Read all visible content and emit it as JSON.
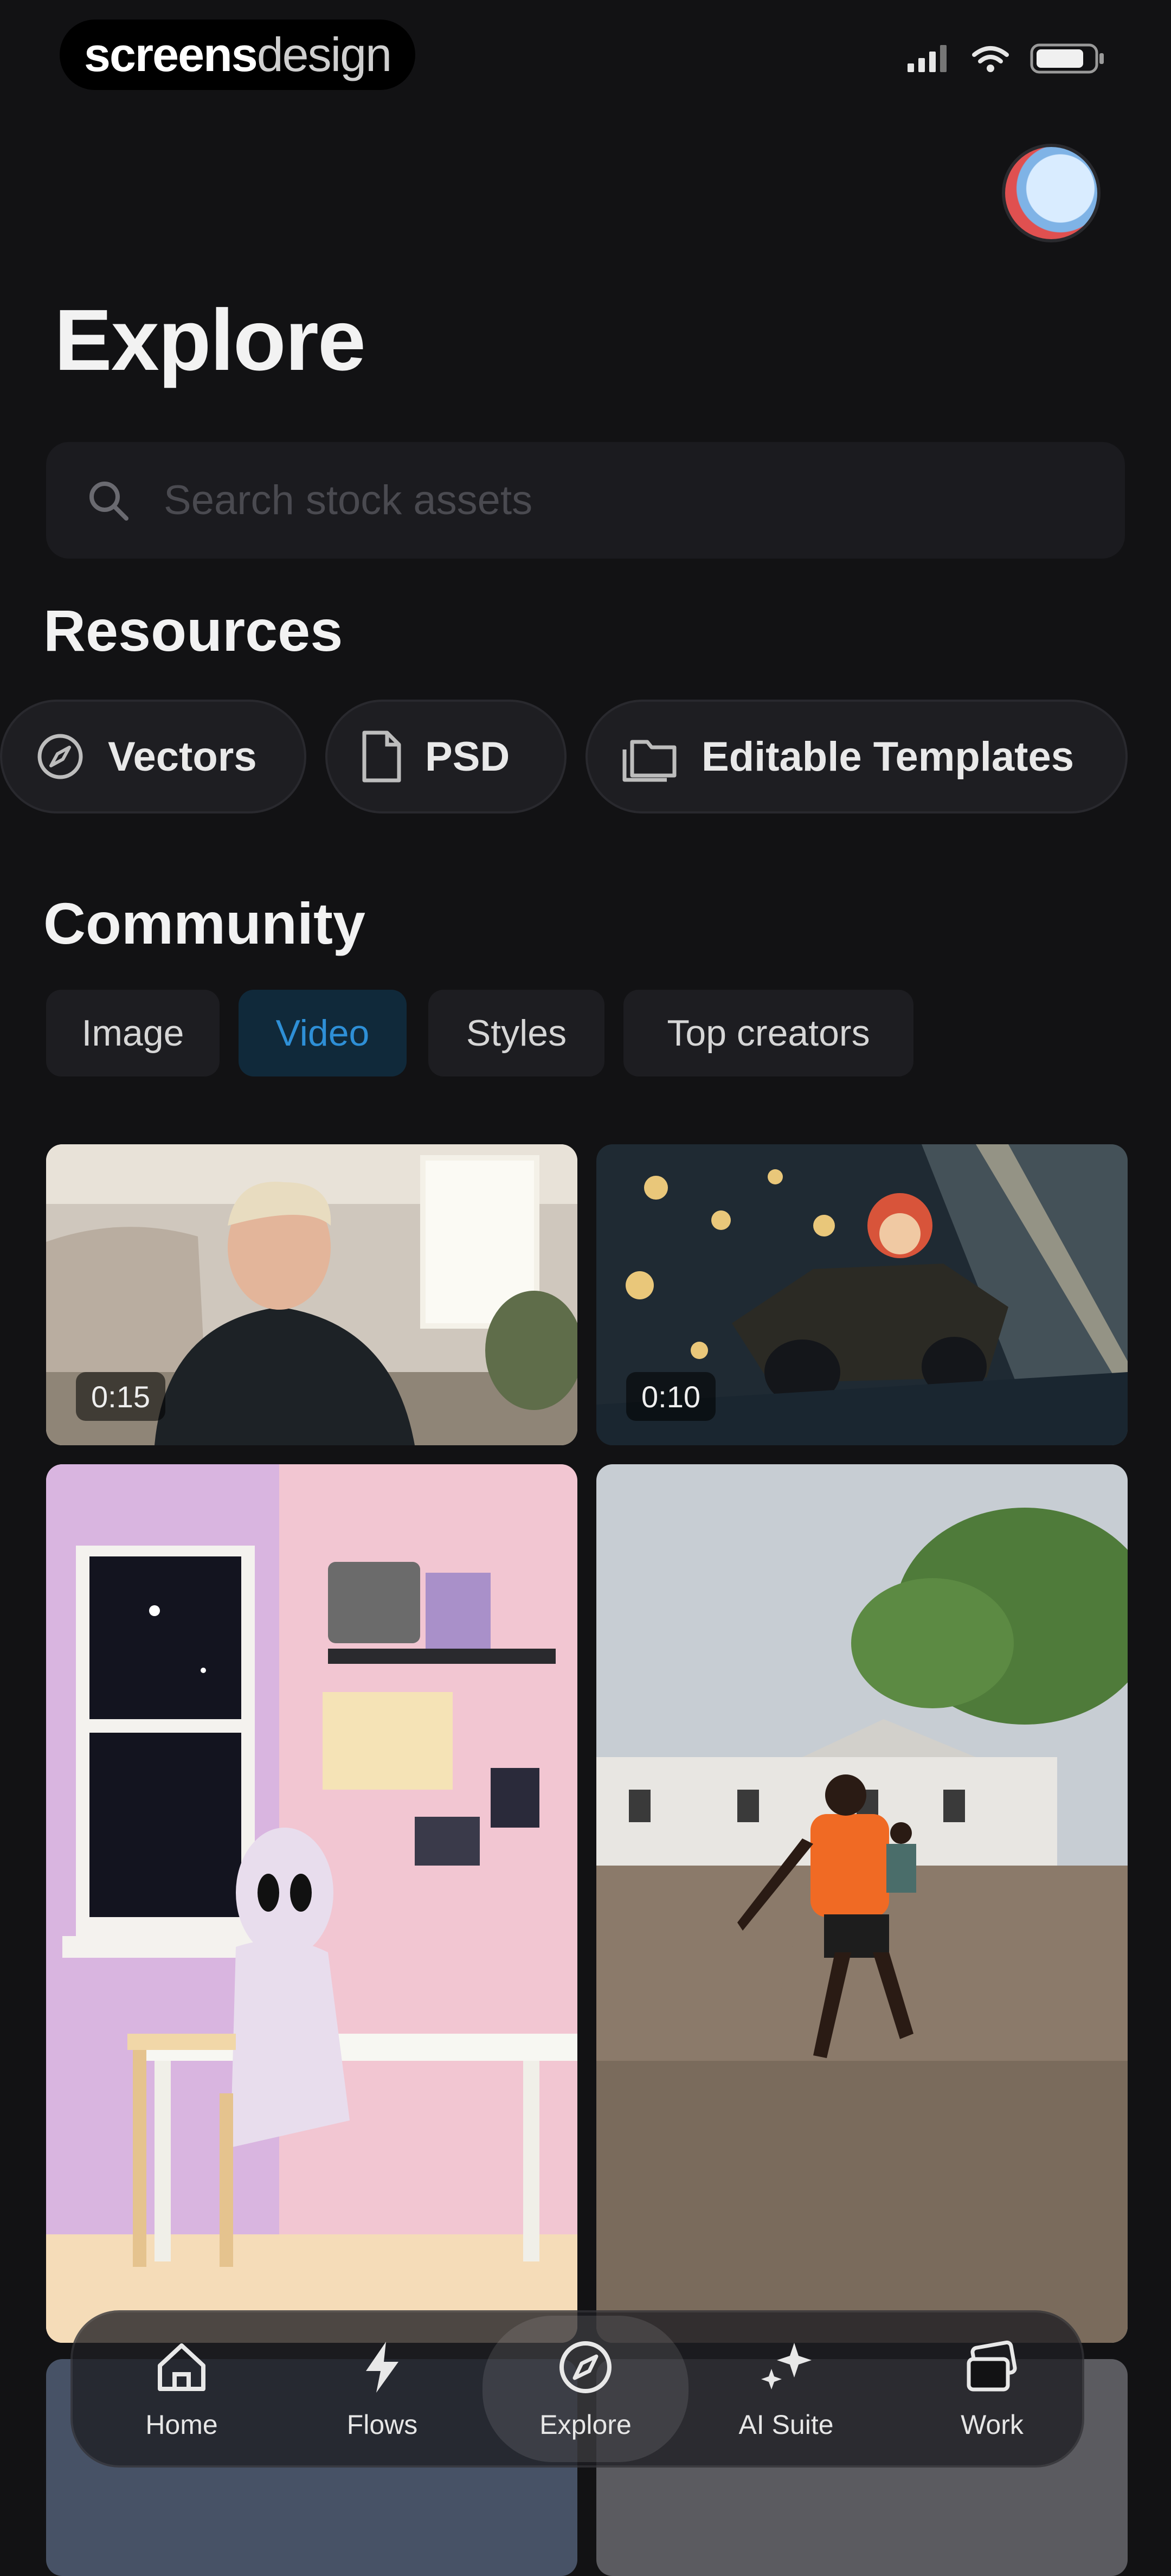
{
  "status_bar": {
    "brand_bold": "screens",
    "brand_light": "design",
    "signal_icon": "signal-icon",
    "wifi_icon": "wifi-icon",
    "battery_icon": "battery-icon"
  },
  "page": {
    "title": "Explore"
  },
  "search": {
    "placeholder": "Search stock assets",
    "value": ""
  },
  "resources": {
    "heading": "Resources",
    "items": [
      {
        "label": "Vectors",
        "icon": "compass-icon"
      },
      {
        "label": "PSD",
        "icon": "document-icon"
      },
      {
        "label": "Editable Templates",
        "icon": "folders-icon"
      }
    ]
  },
  "community": {
    "heading": "Community",
    "tabs": [
      {
        "label": "Image",
        "active": false
      },
      {
        "label": "Video",
        "active": true
      },
      {
        "label": "Styles",
        "active": false
      },
      {
        "label": "Top creators",
        "active": false
      }
    ],
    "cards": [
      {
        "duration": "0:15",
        "subject": "smiling young man in living room"
      },
      {
        "duration": "0:10",
        "subject": "anime character driving through glowing lights"
      },
      {
        "duration": "",
        "subject": "alien sitting at a desk in pastel room"
      },
      {
        "duration": "",
        "subject": "boy in orange jersey playing football"
      }
    ]
  },
  "bottom_nav": {
    "items": [
      {
        "label": "Home",
        "icon": "home-icon",
        "active": false
      },
      {
        "label": "Flows",
        "icon": "lightning-icon",
        "active": false
      },
      {
        "label": "Explore",
        "icon": "compass-icon",
        "active": true
      },
      {
        "label": "AI Suite",
        "icon": "sparkles-icon",
        "active": false
      },
      {
        "label": "Work",
        "icon": "stack-icon",
        "active": false
      }
    ]
  },
  "colors": {
    "background": "#121214",
    "surface": "#1e1e22",
    "accent": "#2e8fd6",
    "active_tab_bg": "#10293a"
  }
}
